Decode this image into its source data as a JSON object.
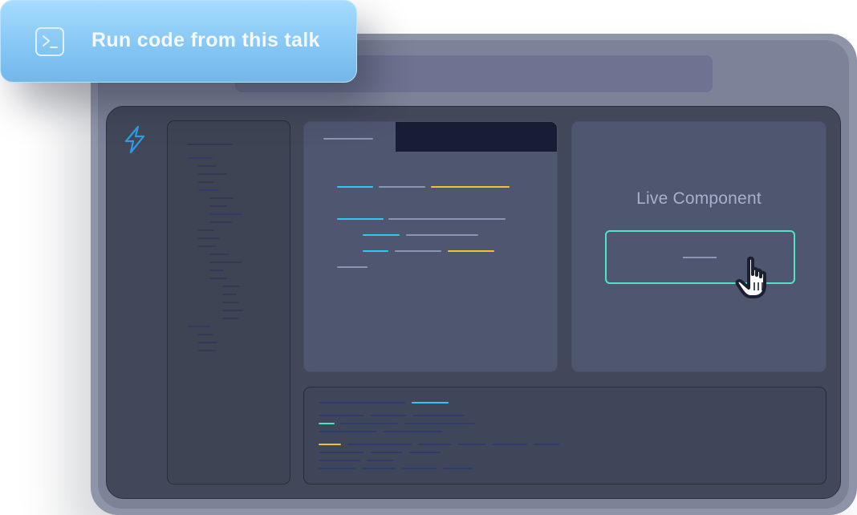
{
  "badge": {
    "label": "Run code from this talk",
    "icon": "terminal-icon"
  },
  "sidebar": {
    "logo_icon": "lightning-bolt-icon"
  },
  "preview": {
    "title": "Live Component"
  },
  "colors": {
    "accent_teal": "#52e3c6",
    "syntax_cyan": "#2dcaf0",
    "syntax_yellow": "#f1c232",
    "badge_blue": "#86c7f4",
    "frame_gray": "#8f95a8",
    "app_bg": "#424859"
  }
}
